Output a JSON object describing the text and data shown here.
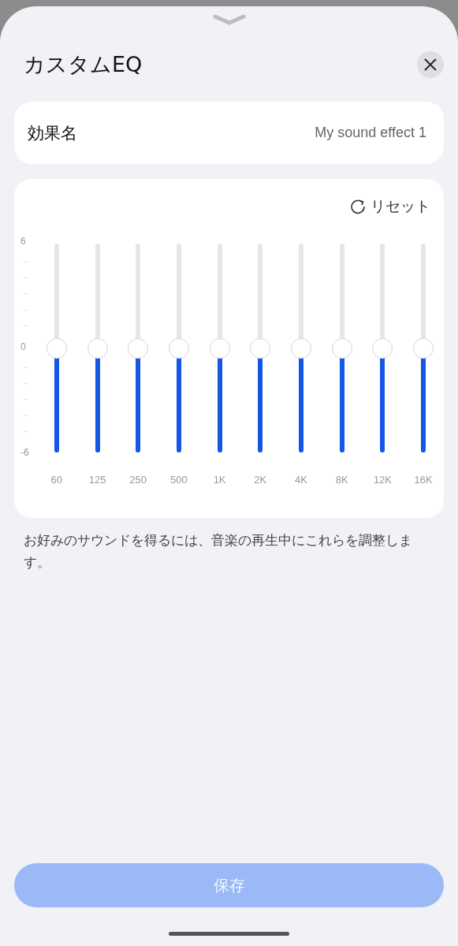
{
  "title": "カスタムEQ",
  "effect_name": {
    "label": "効果名",
    "value": "My sound effect 1"
  },
  "reset": "リセット",
  "scale": [
    "6",
    "0",
    "-6"
  ],
  "bands": [
    {
      "label": "60",
      "level": 0.5
    },
    {
      "label": "125",
      "level": 0.5
    },
    {
      "label": "250",
      "level": 0.5
    },
    {
      "label": "500",
      "level": 0.5
    },
    {
      "label": "1K",
      "level": 0.5
    },
    {
      "label": "2K",
      "level": 0.5
    },
    {
      "label": "4K",
      "level": 0.5
    },
    {
      "label": "8K",
      "level": 0.5
    },
    {
      "label": "12K",
      "level": 0.5
    },
    {
      "label": "16K",
      "level": 0.5
    }
  ],
  "hint": "お好みのサウンドを得るには、音楽の再生中にこれらを調整します。",
  "save_button": {
    "label": "保存",
    "disabled": true
  }
}
